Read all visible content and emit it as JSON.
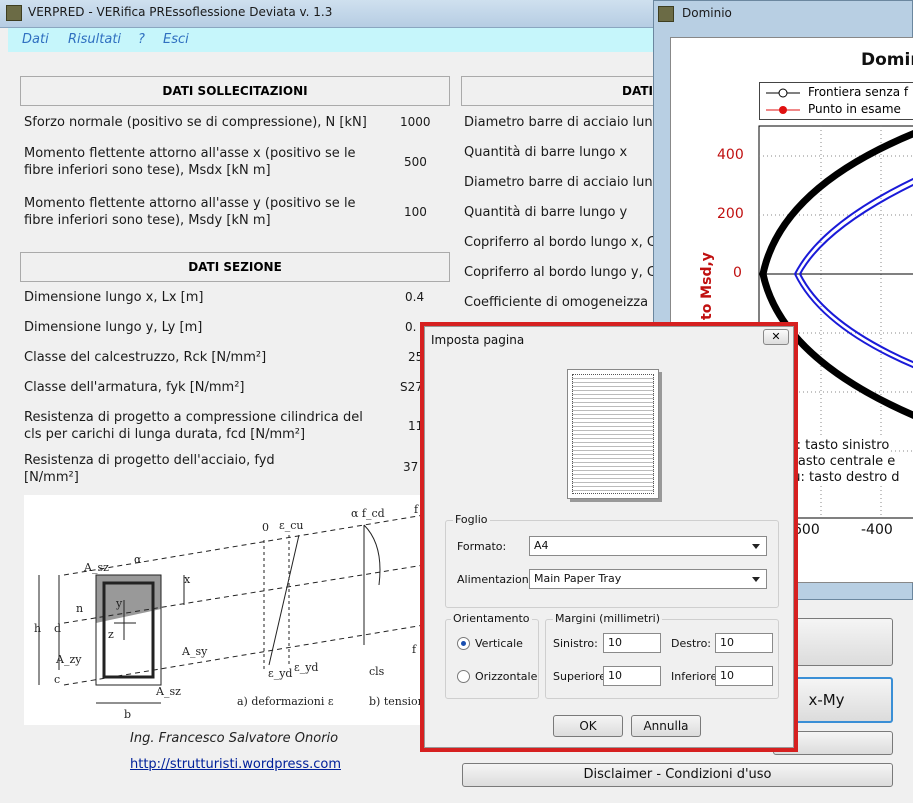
{
  "main_window": {
    "title": "VERPRED - VERifica PREssoflessione Deviata v. 1.3",
    "menu": [
      "Dati",
      "Risultati",
      "?",
      "Esci"
    ]
  },
  "sollecitazioni": {
    "header": "DATI SOLLECITAZIONI",
    "rows": [
      {
        "label": "Sforzo normale (positivo se di compressione), N [kN]",
        "value": "1000"
      },
      {
        "label": "Momento flettente attorno all'asse x (positivo se le fibre inferiori sono tese), Msdx [kN m]",
        "value": "500"
      },
      {
        "label": "Momento flettente attorno all'asse y (positivo se le fibre inferiori sono tese), Msdy [kN m]",
        "value": "100"
      }
    ]
  },
  "sezione": {
    "header": "DATI SEZIONE",
    "rows": [
      {
        "label": "Dimensione lungo x, Lx [m]",
        "value": "0.4"
      },
      {
        "label": "Dimensione lungo y, Ly [m]",
        "value": "0."
      },
      {
        "label": "Classe del calcestruzzo, Rck [N/mm²]",
        "value": "25"
      },
      {
        "label": "Classe dell'armatura, fyk [N/mm²]",
        "value": "S27"
      },
      {
        "label": "Resistenza di progetto a compressione cilindrica del cls per carichi di lunga durata, fcd [N/mm²]",
        "value": "11"
      },
      {
        "label": "Resistenza di progetto dell'acciaio, fyd [N/mm²]",
        "value": "37"
      }
    ]
  },
  "armature": {
    "header": "DATI",
    "rows": [
      "Diametro barre di acciaio lun",
      "Quantità di barre lungo x",
      "Diametro barre di acciaio lun",
      "Quantità di barre lungo y",
      "Copriferro al bordo lungo x, C",
      "Copriferro al bordo lungo y, C",
      "Coefficiente di omogeneizza"
    ]
  },
  "figure": {
    "labels": [
      "0",
      "ε_cu",
      "α f_cd",
      "f",
      "A_sz",
      "α",
      "x",
      "h",
      "d",
      "n",
      "y",
      "z",
      "A_sy",
      "A_zy",
      "c",
      "A_sz",
      "b",
      "ε_yd",
      "ε_yd",
      "cls",
      "f",
      "a) deformazioni ε",
      "b) tension"
    ]
  },
  "author": "Ing. Francesco Salvatore Onorio",
  "link": "http://strutturisti.wordpress.com",
  "buttons": {
    "xmy": "x-My",
    "disclaimer": "Disclaimer - Condizioni d'uso"
  },
  "domain_window": {
    "title": "Dominio",
    "plot_title": "Domin",
    "legend": [
      "Frontiera senza f",
      "Punto in esame"
    ],
    "y_axis_label": "to Msd,y",
    "y_ticks": [
      "400",
      "200",
      "0"
    ],
    "x_ticks": [
      "600",
      "-400"
    ],
    "hints": [
      "om: tasto sinistro",
      "n: tasto centrale e",
      "enu: tasto destro d"
    ],
    "colors": {
      "frontier": "#000000",
      "domain": "#1a1ad8",
      "point": "#e01010",
      "tick": "#c01010"
    }
  },
  "dialog": {
    "title": "Imposta pagina",
    "foglio": {
      "title": "Foglio",
      "formato_label": "Formato:",
      "formato_value": "A4",
      "alimentazione_label": "Alimentazione:",
      "alimentazione_value": "Main Paper Tray"
    },
    "orientamento": {
      "title": "Orientamento",
      "verticale": "Verticale",
      "orizzontale": "Orizzontale",
      "selected": "Verticale"
    },
    "margini": {
      "title": "Margini (millimetri)",
      "sinistro_label": "Sinistro:",
      "sinistro": "10",
      "destro_label": "Destro:",
      "destro": "10",
      "superiore_label": "Superiore:",
      "superiore": "10",
      "inferiore_label": "Inferiore:",
      "inferiore": "10"
    },
    "ok": "OK",
    "annulla": "Annulla",
    "close_glyph": "✕",
    "highlight_color": "#d62020"
  }
}
